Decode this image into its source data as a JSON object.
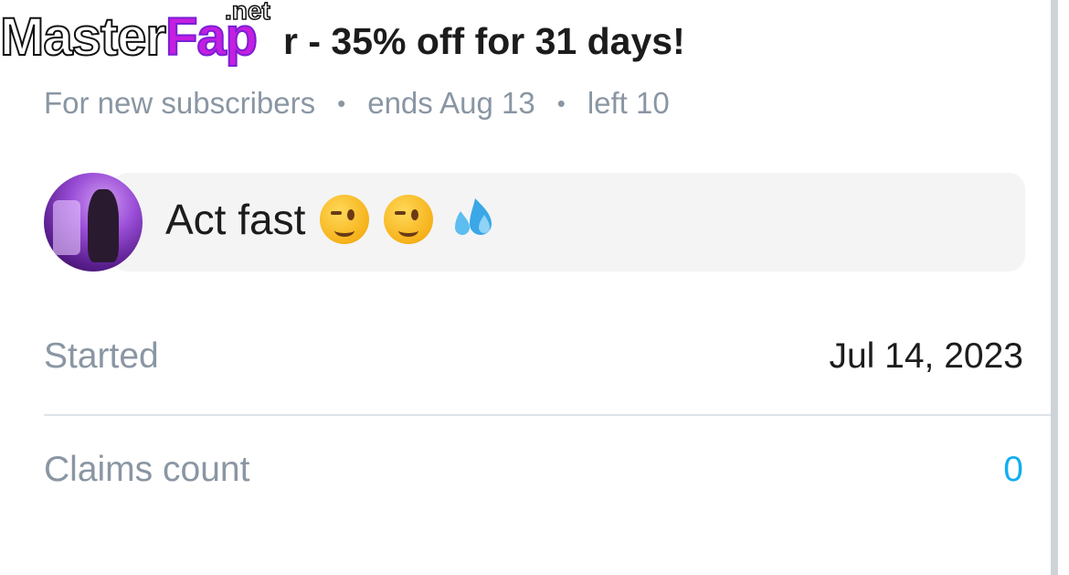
{
  "watermark": {
    "master": "Master",
    "fap": "Fap",
    "net": ".net"
  },
  "offer": {
    "title": "Limited offer - 35% off for 31 days!",
    "visible_title": "r - 35% off for 31 days!",
    "meta": {
      "audience": "For new subscribers",
      "ends": "ends Aug 13",
      "left": "left 10",
      "separator": "•"
    }
  },
  "message": {
    "text": "Act fast",
    "emojis": [
      "winking-face",
      "winking-face",
      "sweat-droplets"
    ]
  },
  "details": {
    "started_label": "Started",
    "started_value": "Jul 14, 2023",
    "claims_label": "Claims count",
    "claims_value": "0"
  },
  "colors": {
    "accent": "#12aef0",
    "muted_text": "#8a96a3",
    "main_text": "#1c1c1c",
    "card_bg": "#f4f4f5",
    "divider": "#dde3e8"
  }
}
